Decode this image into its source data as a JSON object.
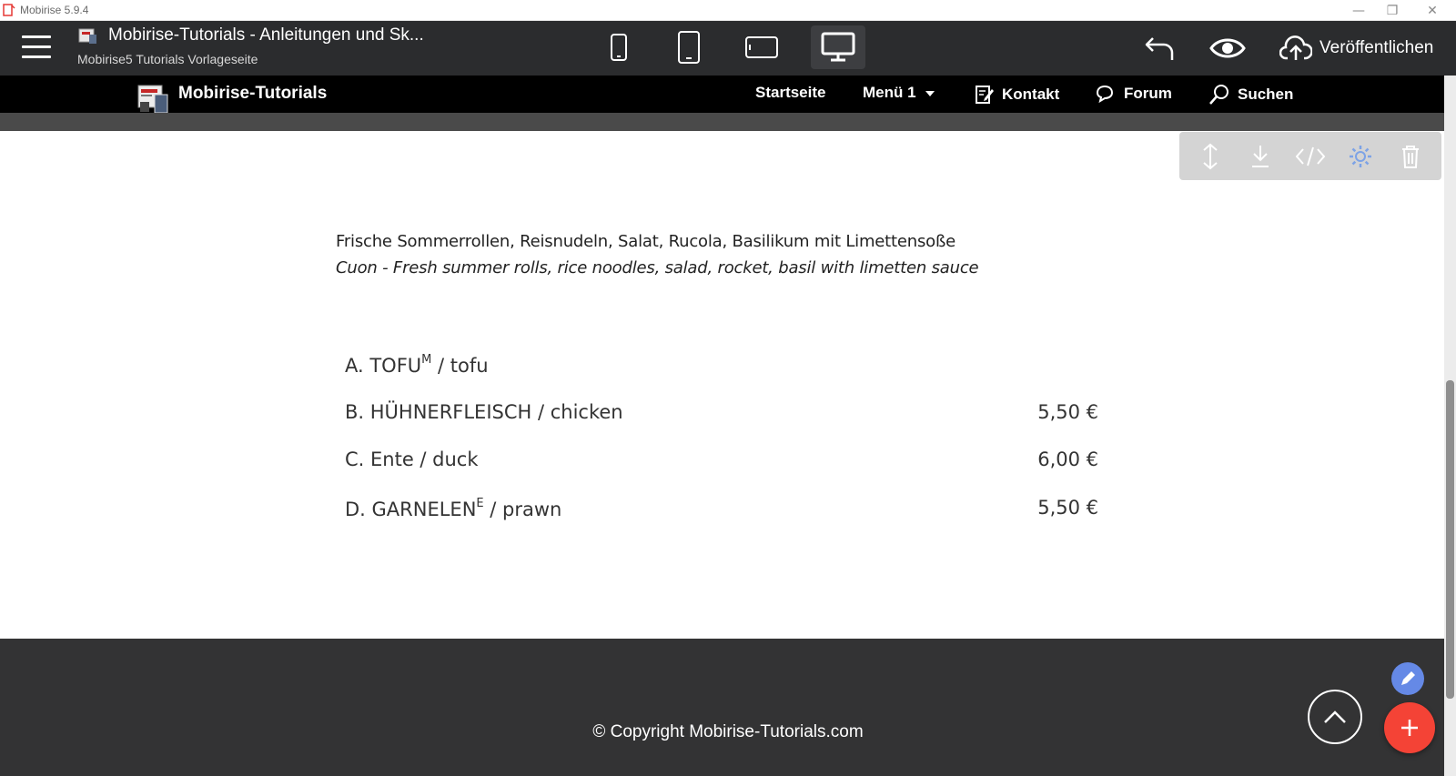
{
  "os_window": {
    "title": "Mobirise 5.9.4",
    "minimize_glyph": "—",
    "maximize_glyph": "❐",
    "close_glyph": "✕"
  },
  "toolbar": {
    "project_title": "Mobirise-Tutorials - Anleitungen und Sk...",
    "project_subtitle": "Mobirise5 Tutorials Vorlageseite",
    "publish_label": "Veröffentlichen",
    "devices": [
      "phone-portrait",
      "tablet-portrait",
      "tablet-landscape",
      "desktop"
    ],
    "active_device": "desktop"
  },
  "site_nav": {
    "brand": "Mobirise-Tutorials",
    "items": [
      {
        "label": "Startseite",
        "icon": null
      },
      {
        "label": "Menü 1",
        "icon": "caret-down-icon"
      },
      {
        "label": "Kontakt",
        "icon": "edit-note-icon"
      },
      {
        "label": "Forum",
        "icon": "chat-bubbles-icon"
      },
      {
        "label": "Suchen",
        "icon": "search-icon"
      }
    ]
  },
  "block_tools": [
    "move-icon",
    "download-icon",
    "code-icon",
    "gear-icon",
    "trash-icon"
  ],
  "content": {
    "description_de": "Frische Sommerrollen, Reisnudeln, Salat, Rucola, Basilikum mit Limettensoße",
    "description_en": "Cuon - Fresh summer rolls, rice noodles, salad, rocket, basil with limetten sauce",
    "menu_items": [
      {
        "prefix": "A. TOFU",
        "sup": "M",
        "suffix": " / tofu",
        "price": ""
      },
      {
        "prefix": "B. HÜHNERFLEISCH / chicken",
        "sup": "",
        "suffix": "",
        "price": "5,50 €"
      },
      {
        "prefix": "C. Ente / duck",
        "sup": "",
        "suffix": "",
        "price": "6,00 €"
      },
      {
        "prefix": "D. GARNELEN",
        "sup": "E",
        "suffix": " / prawn",
        "price": "5,50 €"
      }
    ]
  },
  "footer": {
    "copyright": "© Copyright Mobirise-Tutorials.com"
  },
  "colors": {
    "toolbar_bg": "#2b2c2e",
    "nav_bg": "#000000",
    "footer_bg": "#333334",
    "fab_add": "#f44336",
    "fab_edit": "#6589e6"
  }
}
